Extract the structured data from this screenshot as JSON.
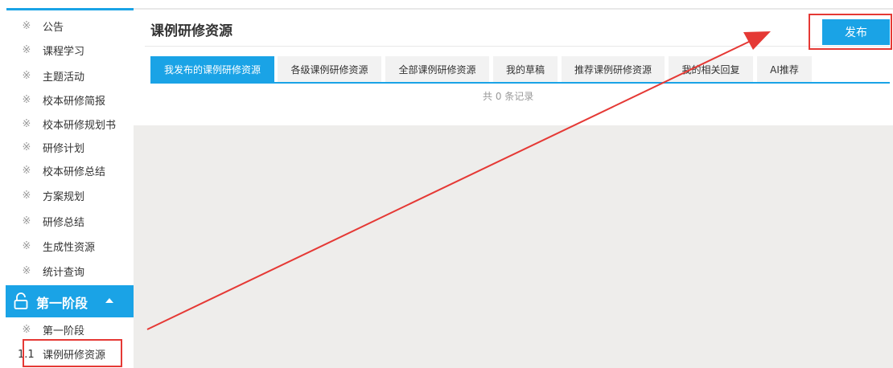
{
  "sidebar": {
    "items": [
      {
        "mark": "※",
        "label": "公告"
      },
      {
        "mark": "※",
        "label": "课程学习"
      },
      {
        "mark": "※",
        "label": "主题活动"
      },
      {
        "mark": "※",
        "label": "校本研修简报"
      },
      {
        "mark": "※",
        "label": "校本研修规划书"
      },
      {
        "mark": "※",
        "label": "研修计划"
      },
      {
        "mark": "※",
        "label": "校本研修总结"
      },
      {
        "mark": "※",
        "label": "方案规划"
      },
      {
        "mark": "※",
        "label": "研修总结"
      },
      {
        "mark": "※",
        "label": "生成性资源"
      },
      {
        "mark": "※",
        "label": "统计查询"
      }
    ],
    "stage": {
      "label": "第一阶段",
      "icon": "unlock-icon",
      "caret": "caret-up-icon"
    },
    "sub_items": [
      {
        "mark": "※",
        "label": "第一阶段"
      },
      {
        "mark": "1.1",
        "label": "课例研修资源"
      }
    ]
  },
  "main": {
    "title": "课例研修资源",
    "publish_label": "发布",
    "tabs": [
      {
        "label": "我发布的课例研修资源",
        "active": true
      },
      {
        "label": "各级课例研修资源",
        "active": false
      },
      {
        "label": "全部课例研修资源",
        "active": false
      },
      {
        "label": "我的草稿",
        "active": false
      },
      {
        "label": "推荐课例研修资源",
        "active": false
      },
      {
        "label": "我的相关回复",
        "active": false
      },
      {
        "label": "AI推荐",
        "active": false
      }
    ],
    "record_count": "共 0 条记录"
  },
  "colors": {
    "accent": "#1aa3e6",
    "annotation_red": "#e53935",
    "content_bg": "#eeedeb"
  }
}
